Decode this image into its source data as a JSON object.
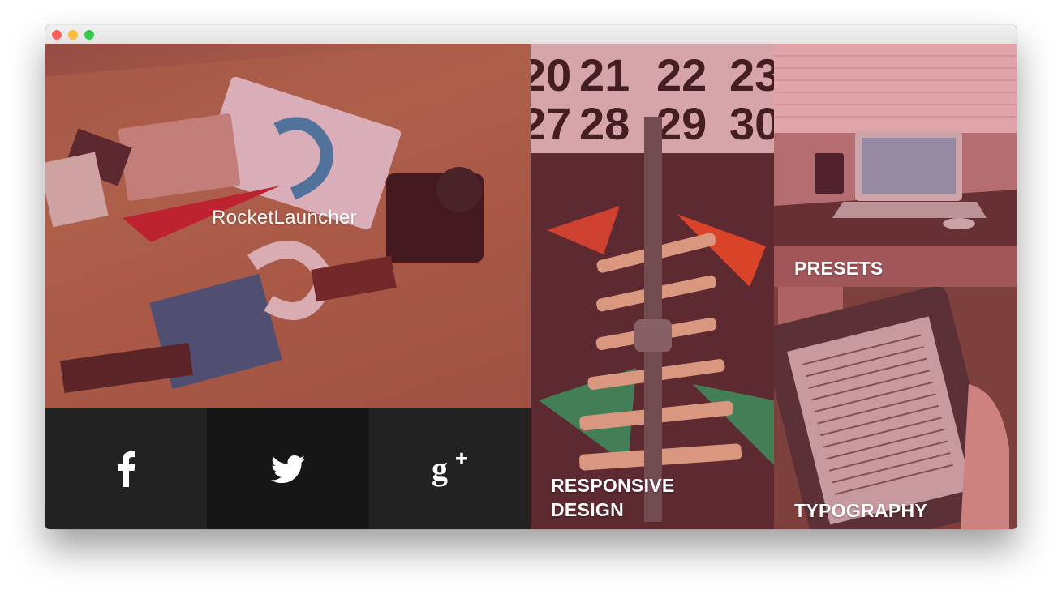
{
  "window": {
    "controls": [
      "close",
      "minimize",
      "maximize"
    ]
  },
  "hero": {
    "title": "RocketLauncher"
  },
  "tiles": {
    "responsive": {
      "line1": "RESPONSIVE",
      "line2": "DESIGN"
    },
    "presets": {
      "label": "PRESETS"
    },
    "typography": {
      "label": "TYPOGRAPHY"
    }
  },
  "calendar_numbers": {
    "row1": [
      "20",
      "21",
      "22",
      "23"
    ],
    "row2": [
      "27",
      "28",
      "29",
      "30"
    ]
  },
  "social": [
    {
      "name": "facebook-icon",
      "glyph": "f"
    },
    {
      "name": "twitter-icon",
      "glyph": "bird"
    },
    {
      "name": "google-plus-icon",
      "glyph": "g+"
    }
  ],
  "colors": {
    "overlay": "#b4283c",
    "social_dark": "#222222",
    "social_darker": "#161616"
  }
}
